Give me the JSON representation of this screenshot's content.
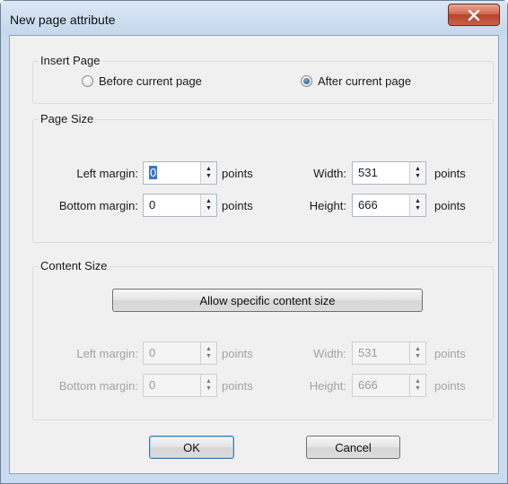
{
  "window": {
    "title": "New page attribute",
    "close_label": "x"
  },
  "insert_page": {
    "group_label": "Insert Page",
    "option_before": "Before current page",
    "option_after": "After current page",
    "selected": "after"
  },
  "page_size": {
    "group_label": "Page Size",
    "left_margin_label": "Left margin:",
    "left_margin_value": "0",
    "bottom_margin_label": "Bottom margin:",
    "bottom_margin_value": "0",
    "width_label": "Width:",
    "width_value": "531",
    "height_label": "Height:",
    "height_value": "666",
    "unit": "points"
  },
  "content_size": {
    "group_label": "Content Size",
    "allow_button": "Allow specific content size",
    "left_margin_label": "Left margin:",
    "left_margin_value": "0",
    "bottom_margin_label": "Bottom margin:",
    "bottom_margin_value": "0",
    "width_label": "Width:",
    "width_value": "531",
    "height_label": "Height:",
    "height_value": "666",
    "unit": "points",
    "enabled": false
  },
  "buttons": {
    "ok": "OK",
    "cancel": "Cancel"
  },
  "icons": {
    "close": "close-icon",
    "spin_up": "spin-up-icon",
    "spin_down": "spin-down-icon"
  },
  "colors": {
    "titlebar": "#c9dbef",
    "close_button": "#c9614a",
    "dialog_bg": "#f0f0f0"
  }
}
